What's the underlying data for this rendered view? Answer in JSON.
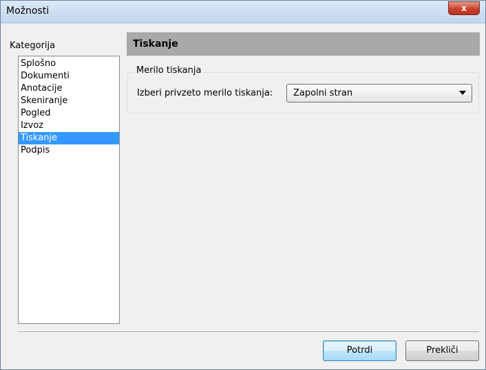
{
  "window": {
    "title": "Možnosti",
    "close_glyph": "x"
  },
  "categories": {
    "label": "Kategorija",
    "items": [
      {
        "label": "Splošno",
        "selected": false
      },
      {
        "label": "Dokumenti",
        "selected": false
      },
      {
        "label": "Anotacije",
        "selected": false
      },
      {
        "label": "Skeniranje",
        "selected": false
      },
      {
        "label": "Pogled",
        "selected": false
      },
      {
        "label": "Izvoz",
        "selected": false
      },
      {
        "label": "Tiskanje",
        "selected": true
      },
      {
        "label": "Podpis",
        "selected": false
      }
    ]
  },
  "panel": {
    "title": "Tiskanje",
    "group": {
      "legend": "Merilo tiskanja",
      "field_label": "Izberi privzeto merilo tiskanja:",
      "combo_value": "Zapolni stran"
    }
  },
  "buttons": {
    "ok": "Potrdi",
    "cancel": "Prekliči"
  },
  "colors": {
    "selection": "#3399ff",
    "header_band": "#a9a9a9",
    "window_bg": "#f0f0f0"
  }
}
